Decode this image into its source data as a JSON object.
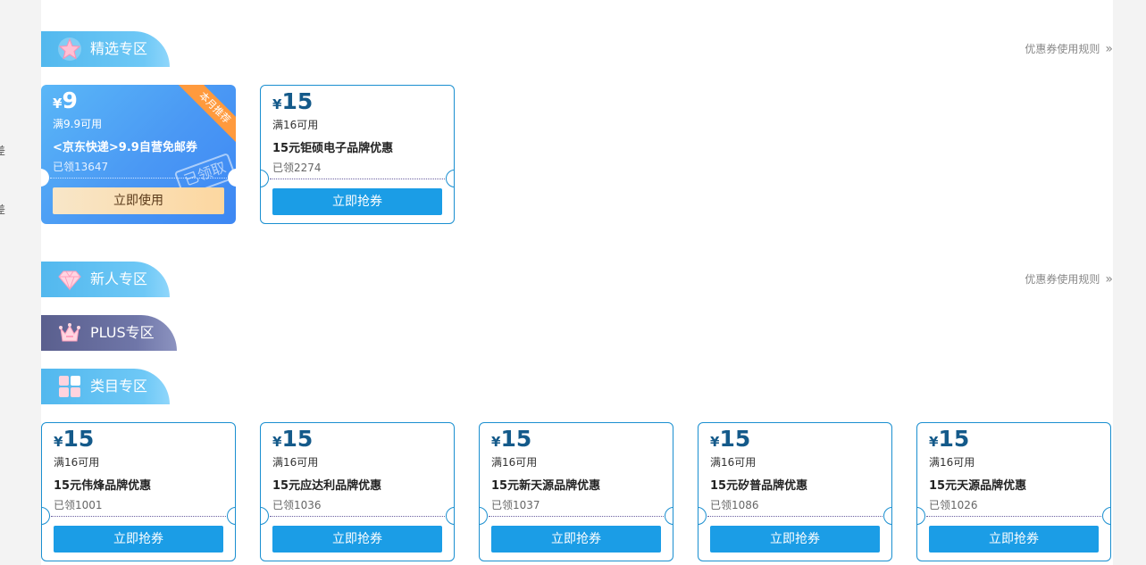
{
  "edge_chars": [
    "差",
    "差"
  ],
  "sections": {
    "featured": {
      "label": "精选专区",
      "rules": "优惠券使用规则",
      "rules_chev": "»"
    },
    "newcomer": {
      "label": "新人专区",
      "rules": "优惠券使用规则",
      "rules_chev": "»"
    },
    "plus": {
      "label": "PLUS专区"
    },
    "category": {
      "label": "类目专区"
    }
  },
  "featured_coupons": [
    {
      "yen": "¥",
      "amount": "9",
      "condition": "满9.9可用",
      "title": "<京东快递>9.9自营免邮券",
      "claimed": "已领13647",
      "button": "立即使用",
      "ribbon": "本月推荐",
      "stamp": "已领取"
    },
    {
      "yen": "¥",
      "amount": "15",
      "condition": "满16可用",
      "title": "15元钜硕电子品牌优惠",
      "claimed": "已领2274",
      "button": "立即抢券"
    }
  ],
  "category_coupons": [
    {
      "yen": "¥",
      "amount": "15",
      "condition": "满16可用",
      "title": "15元伟烽品牌优惠",
      "claimed": "已领1001",
      "button": "立即抢券"
    },
    {
      "yen": "¥",
      "amount": "15",
      "condition": "满16可用",
      "title": "15元应达利品牌优惠",
      "claimed": "已领1036",
      "button": "立即抢券"
    },
    {
      "yen": "¥",
      "amount": "15",
      "condition": "满16可用",
      "title": "15元新天源品牌优惠",
      "claimed": "已领1037",
      "button": "立即抢券"
    },
    {
      "yen": "¥",
      "amount": "15",
      "condition": "满16可用",
      "title": "15元矽普品牌优惠",
      "claimed": "已领1086",
      "button": "立即抢券"
    },
    {
      "yen": "¥",
      "amount": "15",
      "condition": "满16可用",
      "title": "15元天源品牌优惠",
      "claimed": "已领1026",
      "button": "立即抢券"
    }
  ],
  "colors": {
    "tab_blue": "#52b8ee",
    "tab_plus": "#5a5f8e",
    "coupon_border": "#1a8fd0",
    "button_blue": "#1b9de6",
    "amount_text": "#145a8a",
    "ribbon_orange": "#ff9a3d"
  },
  "icons": {
    "featured": "star-icon",
    "newcomer": "diamond-icon",
    "plus": "crown-icon",
    "category": "grid-icon"
  }
}
